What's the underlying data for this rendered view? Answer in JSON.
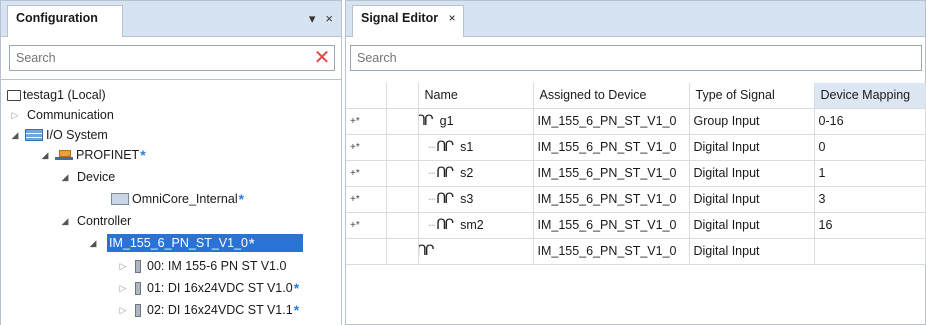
{
  "config_panel": {
    "tab_title": "Configuration",
    "pin_icon": "▾",
    "close_icon": "×",
    "search_placeholder": "Search",
    "clear_icon": "✕"
  },
  "tree": {
    "root": "testag1 (Local)",
    "communication": "Communication",
    "io_system": "I/O System",
    "profinet": "PROFINET",
    "device": "Device",
    "omnicore": "OmniCore_Internal",
    "controller": "Controller",
    "selected_device": "IM_155_6_PN_ST_V1_0",
    "modules": [
      "00: IM 155-6 PN ST V1.0",
      "01: DI 16x24VDC ST V1.0",
      "02: DI 16x24VDC ST V1.1"
    ]
  },
  "signal_editor": {
    "tab_title": "Signal Editor",
    "close_icon": "×",
    "search_placeholder": "Search",
    "columns": {
      "name": "Name",
      "assigned": "Assigned to Device",
      "type": "Type of Signal",
      "mapping": "Device Mapping"
    },
    "add_marker": "+*",
    "rows": [
      {
        "name": "g1",
        "device": "IM_155_6_PN_ST_V1_0",
        "type": "Group Input",
        "mapping": "0-16"
      },
      {
        "name": "s1",
        "device": "IM_155_6_PN_ST_V1_0",
        "type": "Digital Input",
        "mapping": "0"
      },
      {
        "name": "s2",
        "device": "IM_155_6_PN_ST_V1_0",
        "type": "Digital Input",
        "mapping": "1"
      },
      {
        "name": "s3",
        "device": "IM_155_6_PN_ST_V1_0",
        "type": "Digital Input",
        "mapping": "3"
      },
      {
        "name": "sm2",
        "device": "IM_155_6_PN_ST_V1_0",
        "type": "Digital Input",
        "mapping": "16"
      },
      {
        "name": "",
        "device": "IM_155_6_PN_ST_V1_0",
        "type": "Digital Input",
        "mapping": ""
      }
    ]
  },
  "icons": {
    "wave_group": "ՈՈՐ",
    "wave_single": "ՈՐ"
  }
}
